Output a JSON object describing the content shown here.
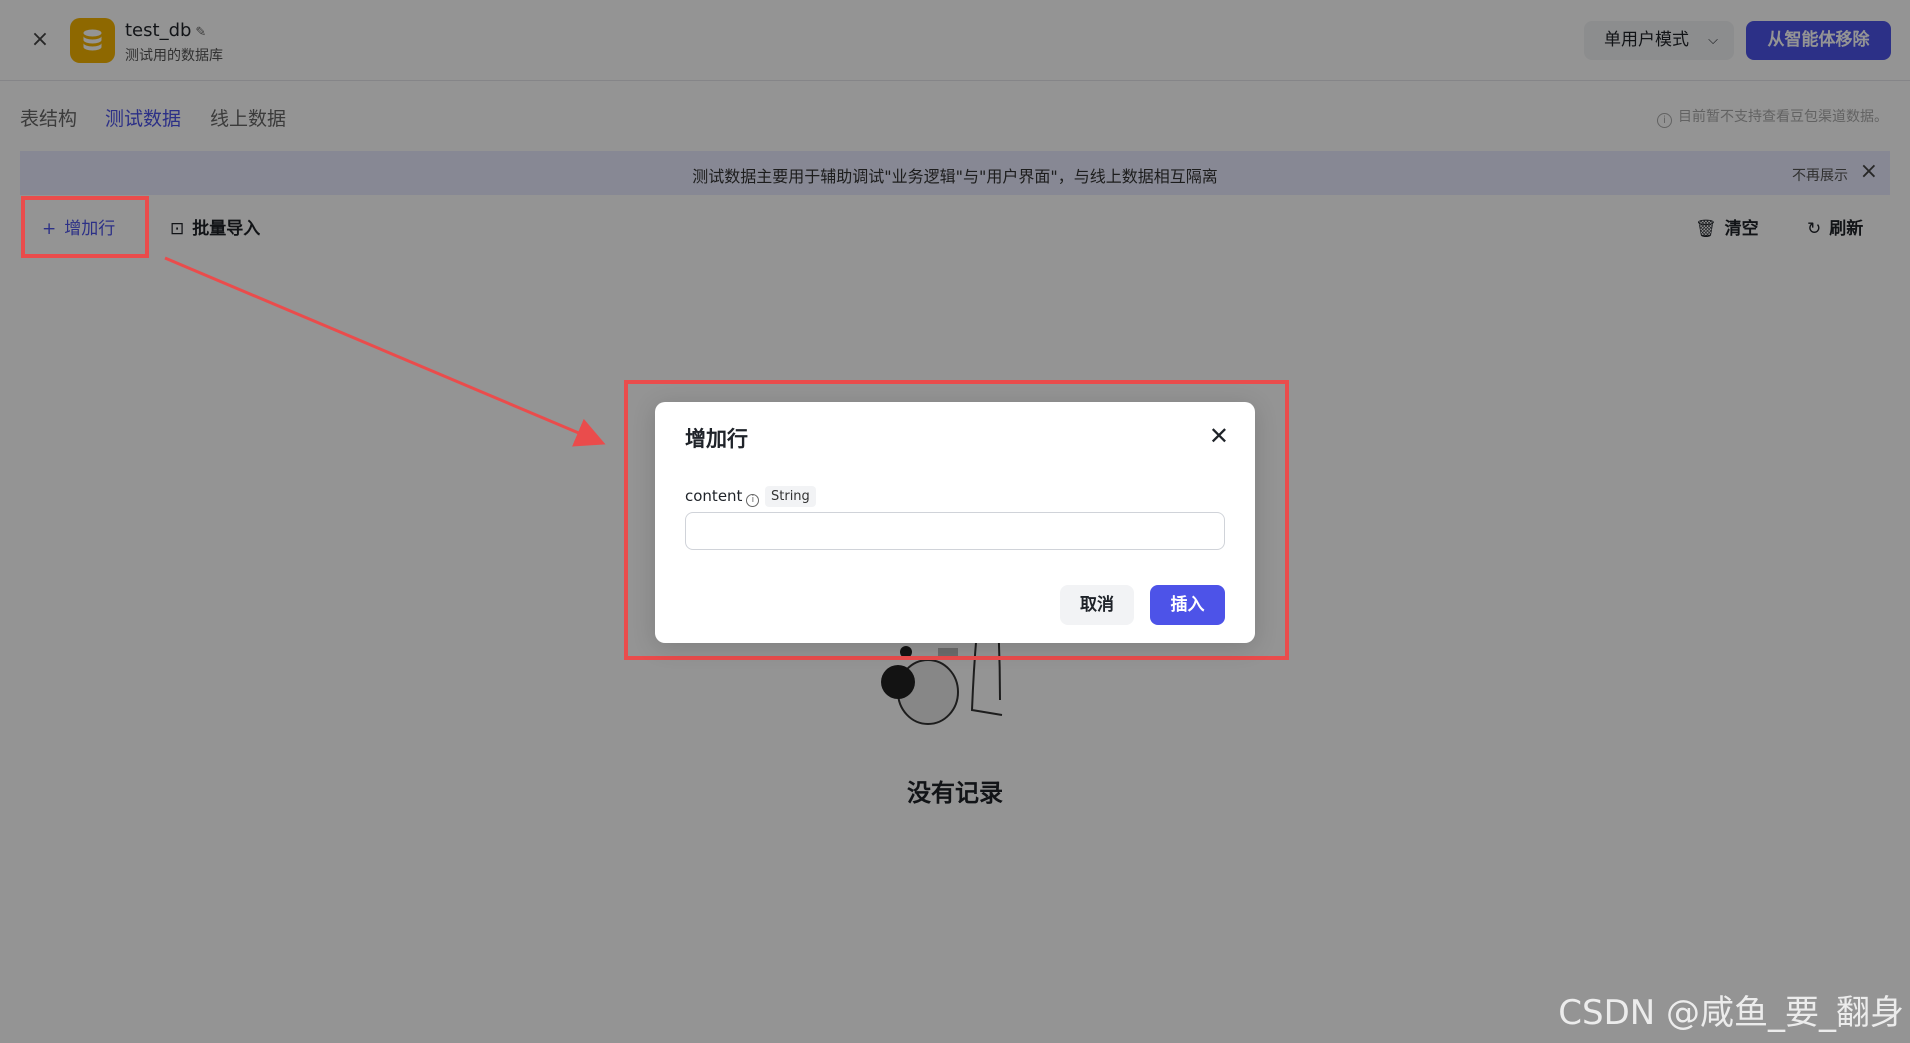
{
  "header": {
    "db_name": "test_db",
    "db_desc": "测试用的数据库",
    "mode_label": "单用户模式",
    "remove_label": "从智能体移除"
  },
  "tabs": [
    {
      "label": "表结构"
    },
    {
      "label": "测试数据"
    },
    {
      "label": "线上数据"
    }
  ],
  "notice_right": "目前暂不支持查看豆包渠道数据。",
  "banner": {
    "text": "测试数据主要用于辅助调试\"业务逻辑\"与\"用户界面\"，与线上数据相互隔离",
    "dismiss": "不再展示"
  },
  "toolbar": {
    "add_row": "增加行",
    "batch_import": "批量导入",
    "clear": "清空",
    "refresh": "刷新"
  },
  "empty": {
    "text": "没有记录"
  },
  "modal": {
    "title": "增加行",
    "field_name": "content",
    "field_type": "String",
    "field_value": "",
    "cancel": "取消",
    "insert": "插入"
  },
  "watermark": "CSDN @咸鱼_要_翻身",
  "colors": {
    "accent": "#4d53e8",
    "annotation": "#ea4c4c",
    "db_icon": "#f5b300"
  }
}
